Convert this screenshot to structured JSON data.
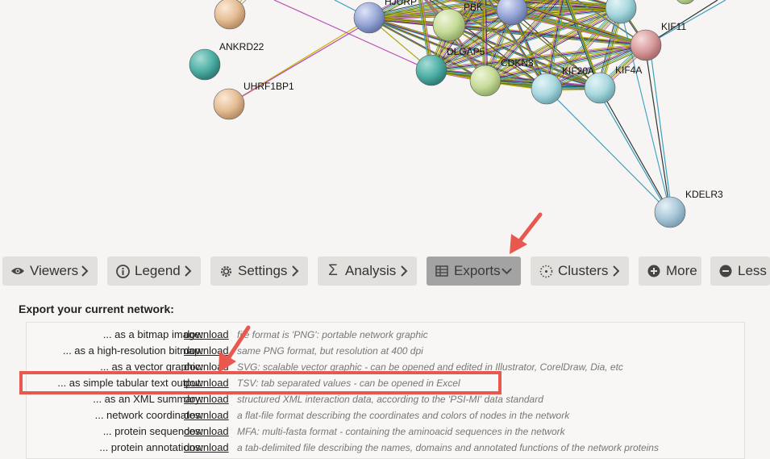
{
  "network": {
    "labels": {
      "hjurp": "HJURP",
      "pbk": "PBK",
      "ankrd22": "ANKRD22",
      "uhrf1bp1": "UHRF1BP1",
      "dlgap5": "DLGAP5",
      "cdkn3": "CDKN3",
      "kif20a": "KIF20A",
      "kif4a": "KIF4A",
      "kif11": "KIF11",
      "kdelr3": "KDELR3"
    }
  },
  "toolbar": {
    "tabs": {
      "viewers": "Viewers",
      "legend": "Legend",
      "settings": "Settings",
      "analysis": "Analysis",
      "exports": "Exports",
      "clusters": "Clusters",
      "more": "More",
      "less": "Less"
    },
    "active_tab": "Exports",
    "active_color": "#a3a3a3"
  },
  "export_panel": {
    "title": "Export your current network:",
    "rows": [
      {
        "label": "... as a bitmap image:",
        "link": "download",
        "desc": "file format is 'PNG': portable network graphic"
      },
      {
        "label": "... as a high-resolution bitmap:",
        "link": "download",
        "desc": "same PNG format, but resolution at 400 dpi"
      },
      {
        "label": "... as a vector graphic:",
        "link": "download",
        "desc": "SVG: scalable vector graphic - can be opened and edited in Illustrator, CorelDraw, Dia, etc"
      },
      {
        "label": "... as simple tabular text output:",
        "link": "download",
        "desc": "TSV: tab separated values - can be opened in Excel"
      },
      {
        "label": "... as an XML summary:",
        "link": "download",
        "desc": "structured XML interaction data, according to the 'PSI-MI' data standard"
      },
      {
        "label": "... network coordinates:",
        "link": "download",
        "desc": "a flat-file format describing the coordinates and colors of nodes in the network"
      },
      {
        "label": "... protein sequences:",
        "link": "download",
        "desc": "MFA: multi-fasta format - containing the aminoacid sequences in the network"
      },
      {
        "label": "... protein annotations:",
        "link": "download",
        "desc": "a tab-delimited file describing the names, domains and annotated functions of the network proteins"
      }
    ]
  },
  "annotation": {
    "highlight_color": "#e8584e"
  }
}
